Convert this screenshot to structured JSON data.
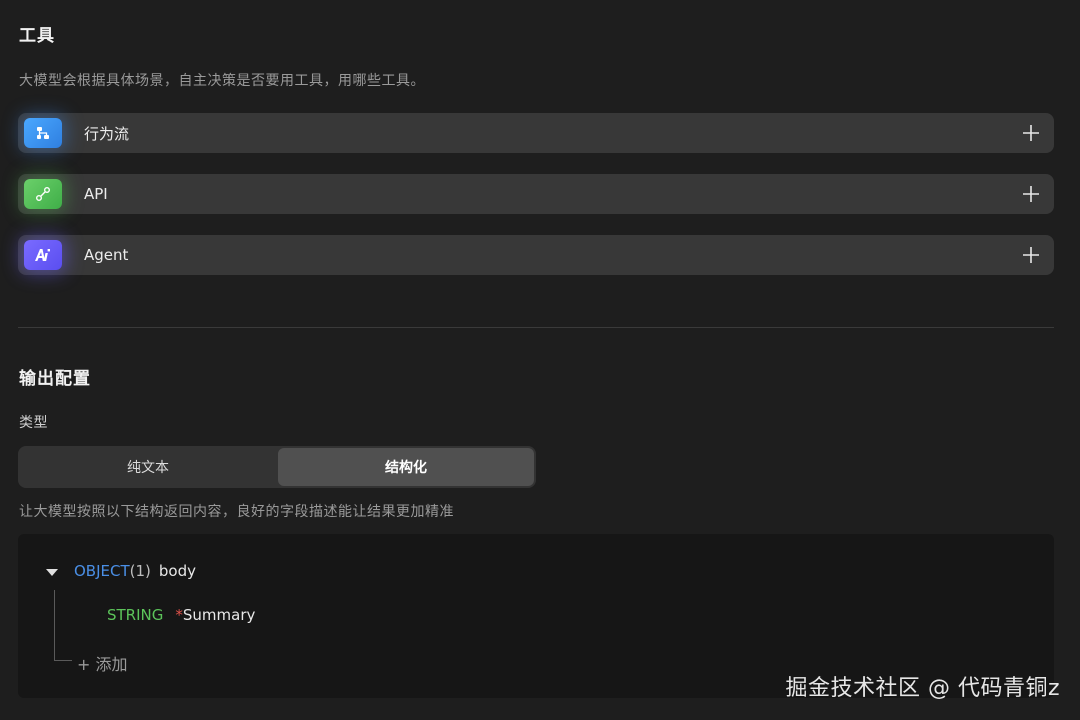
{
  "tools_section": {
    "title": "工具",
    "description": "大模型会根据具体场景，自主决策是否要用工具，用哪些工具。",
    "items": [
      {
        "label": "行为流",
        "icon": "workflow-icon",
        "color": "#3b95f5"
      },
      {
        "label": "API",
        "icon": "link-icon",
        "color": "#52c05a"
      },
      {
        "label": "Agent",
        "icon": "ai-icon",
        "color": "#6a5cf8"
      }
    ]
  },
  "output_section": {
    "title": "输出配置",
    "type_label": "类型",
    "options": [
      "纯文本",
      "结构化"
    ],
    "selected": "结构化",
    "hint": "让大模型按照以下结构返回内容，良好的字段描述能让结果更加精准"
  },
  "schema": {
    "root_type": "OBJECT",
    "root_count": "(1)",
    "root_name": "body",
    "fields": [
      {
        "type": "STRING",
        "required_mark": "*",
        "name": "Summary"
      }
    ],
    "add_label": "+ 添加"
  },
  "watermark": "掘金技术社区 @ 代码青铜z",
  "colors": {
    "background": "#1e1e1e",
    "row": "#383838",
    "object_keyword": "#4a8fe6",
    "string_keyword": "#5cc45a",
    "required": "#e0524a"
  }
}
